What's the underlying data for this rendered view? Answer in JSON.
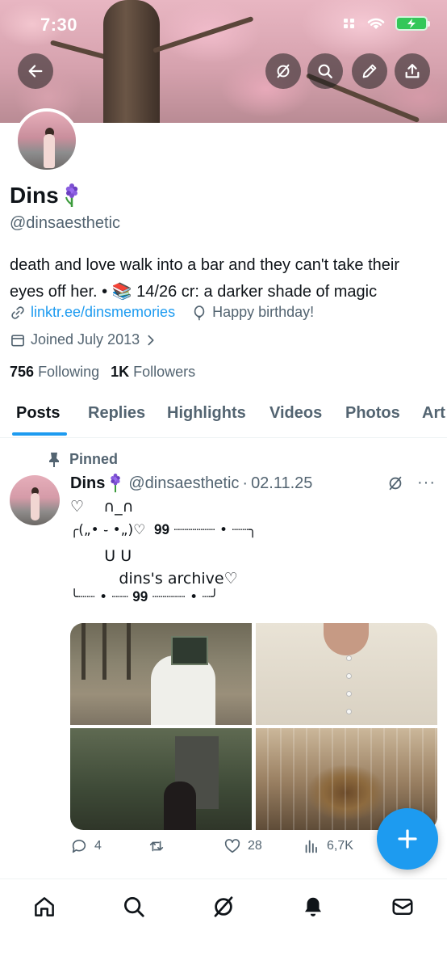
{
  "status_bar": {
    "time": "7:30"
  },
  "profile": {
    "display_name": "Dins",
    "handle": "@dinsaesthetic",
    "bio": "death and love walk into a bar and they can't take their eyes off her. • 📚 14/26 cr: a darker shade of magic",
    "link": "linktr.ee/dinsmemories",
    "birthday": "Happy birthday!",
    "joined": "Joined July 2013",
    "following_count": "756",
    "following_label": "Following",
    "followers_count": "1K",
    "followers_label": "Followers"
  },
  "tabs": [
    {
      "label": "Posts",
      "active": true
    },
    {
      "label": "Replies"
    },
    {
      "label": "Highlights"
    },
    {
      "label": "Videos"
    },
    {
      "label": "Photos"
    },
    {
      "label": "Art"
    }
  ],
  "post": {
    "pinned_label": "Pinned",
    "author_name": "Dins",
    "author_handle": "@dinsaesthetic",
    "separator": "·",
    "date": "02.11.25",
    "lines": [
      "♡    ∩_∩",
      "╭(„• ֊ •„)♡  𝟗𝟗 ┈┈┈┈┈ • ┈┈╮",
      "       U U",
      "          dins's archive♡",
      "╰┈┈ • ┈┈ 𝟗𝟗 ┈┈┈┈ • ┈╯"
    ],
    "stats": {
      "replies": "4",
      "reposts": "",
      "likes": "28",
      "views": "6,7K"
    }
  },
  "icons": {
    "back": "back-arrow-icon",
    "grok": "grok-icon",
    "search": "search-icon",
    "edit": "pencil-icon",
    "share": "share-icon"
  },
  "colors": {
    "accent": "#1d9bf0",
    "text_primary": "#0f1419",
    "text_secondary": "#536471"
  }
}
